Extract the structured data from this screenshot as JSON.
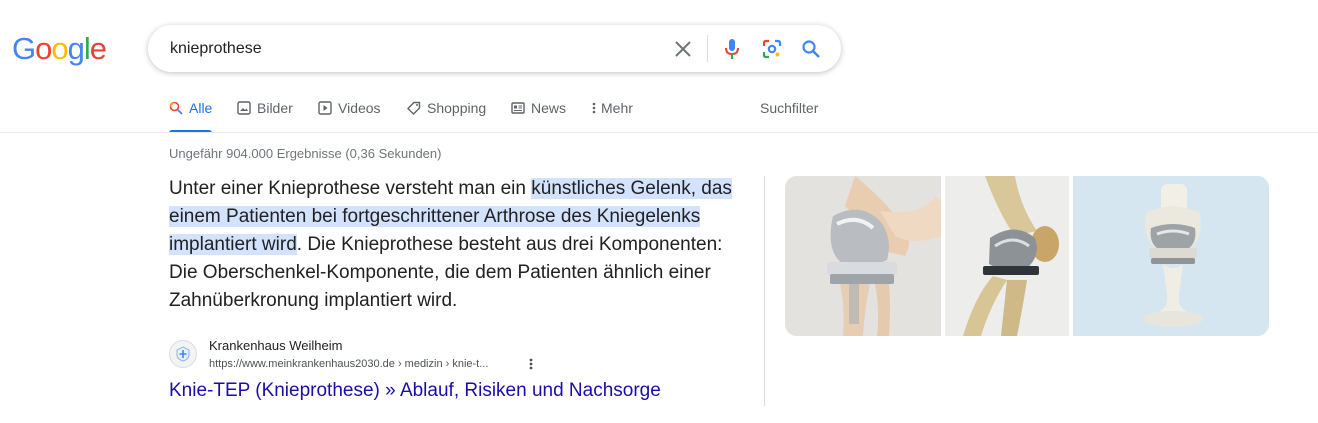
{
  "logo": {
    "letters": [
      "G",
      "o",
      "o",
      "g",
      "l",
      "e"
    ],
    "colors": [
      "#4285F4",
      "#EA4335",
      "#FBBC05",
      "#4285F4",
      "#34A853",
      "#EA4335"
    ]
  },
  "search": {
    "query": "knieprothese",
    "icons": [
      "clear-icon",
      "microphone-icon",
      "lens-icon",
      "search-icon"
    ]
  },
  "tabs": [
    {
      "label": "Alle",
      "icon": "search-icon",
      "active": true
    },
    {
      "label": "Bilder",
      "icon": "image-icon",
      "active": false
    },
    {
      "label": "Videos",
      "icon": "play-icon",
      "active": false
    },
    {
      "label": "Shopping",
      "icon": "tag-icon",
      "active": false
    },
    {
      "label": "News",
      "icon": "news-icon",
      "active": false
    },
    {
      "label": "Mehr",
      "icon": "more-vert-icon",
      "active": false
    },
    {
      "label": "Suchfilter",
      "icon": "",
      "active": false
    }
  ],
  "result_stats": "Ungefähr 904.000 Ergebnisse (0,36 Sekunden)",
  "snippet": {
    "before": "Unter einer Knieprothese versteht man ein ",
    "highlight": "künstliches Gelenk, das einem Patienten bei fortgeschrittener Arthrose des Kniegelenks implantiert wird",
    "after": ". Die Knieprothese besteht aus drei Komponenten: Die Oberschenkel-Komponente, die dem Patienten ähnlich einer Zahnüberkronung implantiert wird."
  },
  "source": {
    "name": "Krankenhaus Weilheim",
    "url": "https://www.meinkrankenhaus2030.de › medizin › knie-t..."
  },
  "result_title": "Knie-TEP (Knieprothese) » Ablauf, Risiken und Nachsorge",
  "colors": {
    "link": "#1a0dab",
    "accent": "#1a73e8",
    "highlight": "#d3e3fd"
  }
}
